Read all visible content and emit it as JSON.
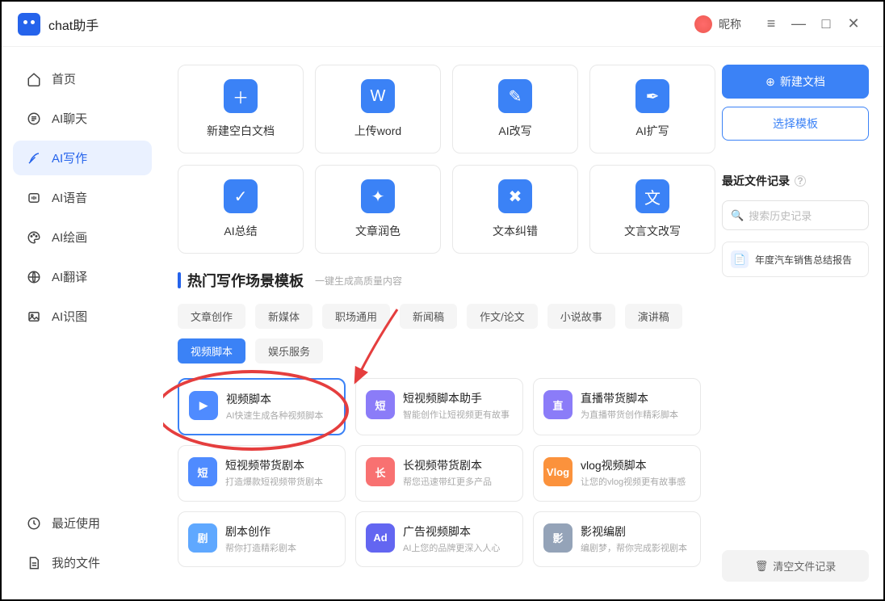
{
  "app": {
    "title": "chat助手",
    "user_nickname": "昵称"
  },
  "sidebar": {
    "items": [
      {
        "label": "首页"
      },
      {
        "label": "AI聊天"
      },
      {
        "label": "AI写作"
      },
      {
        "label": "AI语音"
      },
      {
        "label": "AI绘画"
      },
      {
        "label": "AI翻译"
      },
      {
        "label": "AI识图"
      }
    ],
    "bottom": [
      {
        "label": "最近使用"
      },
      {
        "label": "我的文件"
      }
    ]
  },
  "tools": [
    {
      "label": "新建空白文档"
    },
    {
      "label": "上传word"
    },
    {
      "label": "AI改写"
    },
    {
      "label": "AI扩写"
    },
    {
      "label": "AI总结"
    },
    {
      "label": "文章润色"
    },
    {
      "label": "文本纠错"
    },
    {
      "label": "文言文改写"
    }
  ],
  "section": {
    "title": "热门写作场景模板",
    "hint": "一键生成高质量内容"
  },
  "tabs": [
    "文章创作",
    "新媒体",
    "职场通用",
    "新闻稿",
    "作文/论文",
    "小说故事",
    "演讲稿",
    "视频脚本",
    "娱乐服务"
  ],
  "templates": [
    {
      "title": "视频脚本",
      "desc": "AI快速生成各种视频脚本"
    },
    {
      "title": "短视频脚本助手",
      "desc": "智能创作让短视频更有故事"
    },
    {
      "title": "直播带货脚本",
      "desc": "为直播带货创作精彩脚本"
    },
    {
      "title": "短视频带货剧本",
      "desc": "打造爆款短视频带货剧本"
    },
    {
      "title": "长视频带货剧本",
      "desc": "帮您迅速带红更多产品"
    },
    {
      "title": "vlog视频脚本",
      "desc": "让您的vlog视频更有故事感"
    },
    {
      "title": "剧本创作",
      "desc": "帮你打造精彩剧本"
    },
    {
      "title": "广告视频脚本",
      "desc": "AI上您的品牌更深入人心"
    },
    {
      "title": "影视编剧",
      "desc": "编剧梦，帮你完成影视剧本"
    }
  ],
  "right": {
    "new_doc": "新建文档",
    "select_tpl": "选择模板",
    "recent_title": "最近文件记录",
    "search_placeholder": "搜索历史记录",
    "file_name": "年度汽车销售总结报告",
    "clear": "清空文件记录"
  }
}
